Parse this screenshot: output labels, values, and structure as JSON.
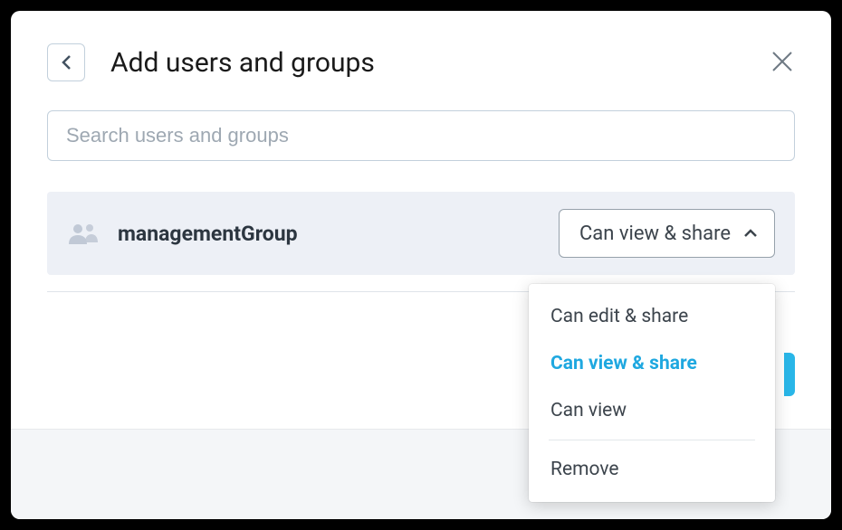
{
  "dialog": {
    "title": "Add users and groups"
  },
  "search": {
    "placeholder": "Search users and groups",
    "value": ""
  },
  "group": {
    "name": "managementGroup",
    "selectedPermission": "Can view & share"
  },
  "permissionMenu": {
    "options": [
      {
        "label": "Can edit & share",
        "selected": false
      },
      {
        "label": "Can view & share",
        "selected": true
      },
      {
        "label": "Can view",
        "selected": false
      }
    ],
    "removeLabel": "Remove"
  }
}
